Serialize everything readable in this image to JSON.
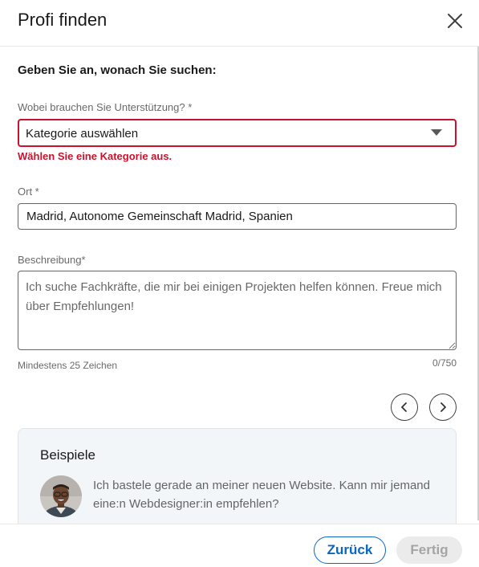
{
  "header": {
    "title": "Profi finden",
    "close_icon": "close-icon"
  },
  "form": {
    "prompt": "Geben Sie an, wonach Sie suchen:",
    "category": {
      "label": "Wobei brauchen Sie Unterstützung? *",
      "value": "Kategorie auswählen",
      "error": "Wählen Sie eine Kategorie aus.",
      "error_color": "#cb112d"
    },
    "location": {
      "label": "Ort *",
      "value": "Madrid, Autonome Gemeinschaft Madrid, Spanien"
    },
    "description": {
      "label": "Beschreibung*",
      "placeholder": "Ich suche Fachkräfte, die mir bei einigen Projekten helfen können. Freue mich über Empfehlungen!",
      "hint": "Mindestens 25 Zeichen",
      "counter": "0/750"
    }
  },
  "carousel": {
    "prev_icon": "chevron-left-icon",
    "next_icon": "chevron-right-icon"
  },
  "examples": {
    "title": "Beispiele",
    "text": "Ich bastele gerade an meiner neuen Website. Kann mir jemand eine:n Webdesigner:in empfehlen?"
  },
  "footer": {
    "back_label": "Zurück",
    "done_label": "Fertig",
    "accent_color": "#0a66c2"
  }
}
